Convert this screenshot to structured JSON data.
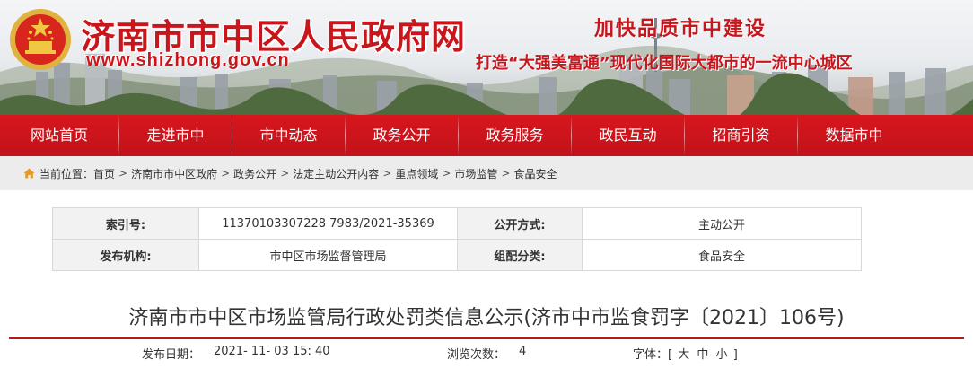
{
  "banner": {
    "site_title": "济南市市中区人民政府网",
    "site_url": "www.shizhong.gov.cn",
    "slogan_main": "加快品质市中建设",
    "slogan_sub": "打造“大强美富通”现代化国际大都市的一流中心城区",
    "colors": {
      "brand_red": "#c8161d"
    }
  },
  "nav": {
    "items": [
      {
        "label": "网站首页"
      },
      {
        "label": "走进市中"
      },
      {
        "label": "市中动态"
      },
      {
        "label": "政务公开"
      },
      {
        "label": "政务服务"
      },
      {
        "label": "政民互动"
      },
      {
        "label": "招商引资"
      },
      {
        "label": "数据市中"
      }
    ],
    "colors": {
      "bar_red": "#c9141c"
    }
  },
  "breadcrumb": {
    "icon": "home-icon",
    "label": "当前位置：",
    "items": [
      "首页",
      "济南市市中区政府",
      "政务公开",
      "法定主动公开内容",
      "重点领域",
      "市场监管",
      "食品安全"
    ],
    "separator": ">"
  },
  "meta": {
    "index_label": "索引号:",
    "index_value": "11370103307228 7983/2021-35369",
    "open_mode_label": "公开方式:",
    "open_mode_value": "主动公开",
    "publisher_label": "发布机构:",
    "publisher_value": "市中区市场监督管理局",
    "category_label": "组配分类:",
    "category_value": "食品安全"
  },
  "article": {
    "title": "济南市市中区市场监管局行政处罚类信息公示(济市中市监食罚字〔2021〕106号)",
    "publish_label": "发布日期：",
    "publish_value": "2021- 11- 03 15: 40",
    "views_label": "浏览次数：",
    "views_value": "4",
    "font_label": "字体：",
    "font_options": [
      "大",
      "中",
      "小"
    ]
  }
}
